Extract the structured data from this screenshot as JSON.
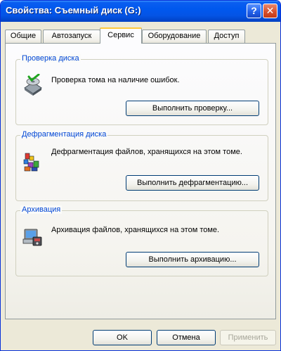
{
  "window": {
    "title": "Свойства: Съемный диск (G:)",
    "help_label": "?",
    "close_label": "✕"
  },
  "tabs": [
    {
      "label": "Общие",
      "active": false
    },
    {
      "label": "Автозапуск",
      "active": false
    },
    {
      "label": "Сервис",
      "active": true
    },
    {
      "label": "Оборудование",
      "active": false
    },
    {
      "label": "Доступ",
      "active": false
    }
  ],
  "groups": {
    "check": {
      "title": "Проверка диска",
      "description": "Проверка тома на наличие ошибок.",
      "button": "Выполнить проверку...",
      "icon": "disk-check-icon"
    },
    "defrag": {
      "title": "Дефрагментация диска",
      "description": "Дефрагментация файлов, хранящихся на этом томе.",
      "button": "Выполнить дефрагментацию...",
      "icon": "defrag-icon"
    },
    "backup": {
      "title": "Архивация",
      "description": "Архивация файлов, хранящихся на этом томе.",
      "button": "Выполнить архивацию...",
      "icon": "backup-icon"
    }
  },
  "footer": {
    "ok": "OK",
    "cancel": "Отмена",
    "apply": "Применить"
  },
  "colors": {
    "titlebar": "#0058ee",
    "group_title": "#0046d5",
    "active_tab_accent": "#ffc83c"
  }
}
